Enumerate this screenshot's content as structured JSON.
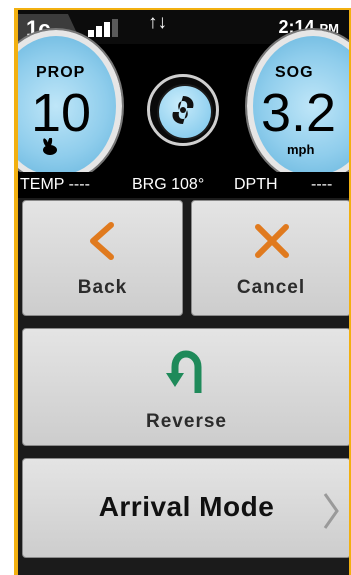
{
  "status_bar": {
    "device_id": "1c",
    "time": "2:14",
    "time_suffix": "PM"
  },
  "gauges": {
    "prop": {
      "label": "PROP",
      "value": "10"
    },
    "sog": {
      "label": "SOG",
      "value": "3.2",
      "unit": "mph"
    }
  },
  "readouts": {
    "temp": "TEMP ----",
    "brg": "BRG  108°",
    "dpth_label": "DPTH",
    "dpth_value": "----"
  },
  "buttons": {
    "back": "Back",
    "cancel": "Cancel",
    "reverse": "Reverse",
    "arrival_mode": "Arrival Mode"
  },
  "colors": {
    "frame": "#f2b010",
    "dial": "#8fcdec",
    "back_arrow": "#e07a1e",
    "reverse_icon": "#1f8a5a"
  },
  "icons": [
    "signal-icon",
    "data-arrows-icon",
    "rabbit-icon",
    "steering-compass-icon",
    "chevron-left-icon",
    "close-x-icon",
    "u-turn-arrow-icon",
    "chevron-right-icon"
  ]
}
